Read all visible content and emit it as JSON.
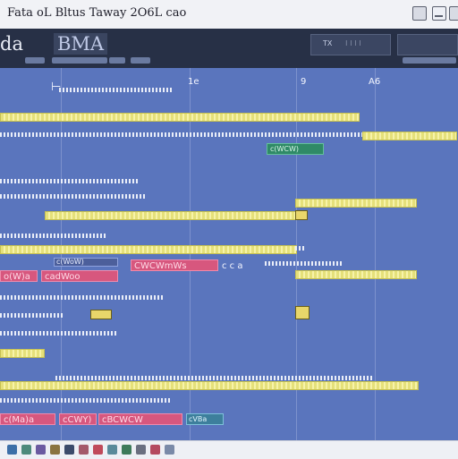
{
  "window": {
    "title": "Fata oL Bltus Taway 2O6L cao",
    "icons": [
      "restore-icon",
      "minimize-icon",
      "maximize-icon"
    ]
  },
  "toolbar": {
    "app_name": "da",
    "app_sub": "BMA",
    "field_1": "TX",
    "field_2": "",
    "field_3": "",
    "strips": [
      "",
      "",
      "",
      "",
      ""
    ]
  },
  "workspace": {
    "column_headers": [
      "1e",
      "9",
      "A6"
    ],
    "pink_labels": [
      "o(W)a",
      "cadWoo",
      "CWCWmWs",
      "c(Ma)a",
      "cCWY)",
      "cBCWCW"
    ],
    "green_label": "c(WCW)",
    "teal_label": "cVBa",
    "slate_label": "c(WoW)",
    "accent_colors": {
      "bg": "#5a75bd",
      "bar": "#e5e07a",
      "pink": "#d7577e",
      "green": "#2f8a67",
      "teal": "#3d7f9c"
    }
  },
  "statusbar": {
    "icons": [
      "home-icon",
      "grid-icon",
      "chart-icon",
      "folder-icon",
      "clip-icon",
      "stack-icon",
      "heart-icon",
      "panel-icon",
      "pin-icon",
      "settings-icon",
      "tag-icon",
      "user-icon"
    ]
  }
}
